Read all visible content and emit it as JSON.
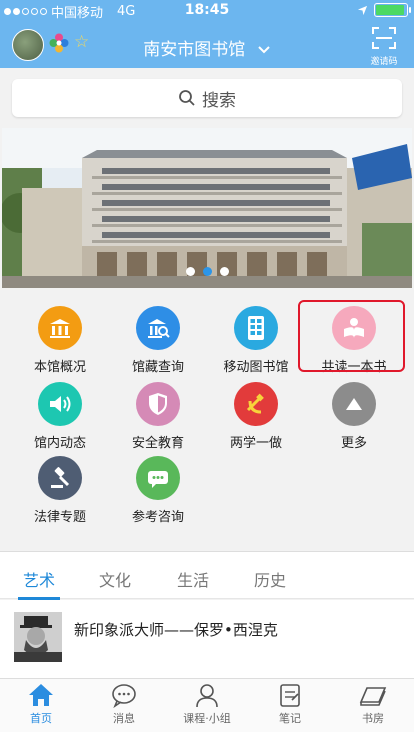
{
  "status_bar": {
    "carrier": "中国移动",
    "network": "4G",
    "time": "18:45",
    "battery_level": 0.85
  },
  "header": {
    "title": "南安市图书馆",
    "scan_label": "邀请码"
  },
  "search": {
    "placeholder": "搜索"
  },
  "banner": {
    "page_count": 3,
    "active_page": 2
  },
  "features": [
    {
      "label": "本馆概况",
      "icon": "library-building-icon",
      "color": "#f39c12"
    },
    {
      "label": "馆藏查询",
      "icon": "search-building-icon",
      "color": "#2e8ee6"
    },
    {
      "label": "移动图书馆",
      "icon": "mobile-library-icon",
      "color": "#2aa9e0"
    },
    {
      "label": "共读一本书",
      "icon": "reading-icon",
      "color": "#f6a9bd"
    },
    {
      "label": "馆内动态",
      "icon": "speaker-icon",
      "color": "#1dc7b1"
    },
    {
      "label": "安全教育",
      "icon": "shield-icon",
      "color": "#d58ab6"
    },
    {
      "label": "两学一做",
      "icon": "party-emblem-icon",
      "color": "#e23b3b"
    },
    {
      "label": "更多",
      "icon": "up-arrow-icon",
      "color": "#8c8c8c"
    },
    {
      "label": "法律专题",
      "icon": "gavel-icon",
      "color": "#4f5d73"
    },
    {
      "label": "参考咨询",
      "icon": "chat-bubble-icon",
      "color": "#59b85a"
    }
  ],
  "category_tabs": [
    "艺术",
    "文化",
    "生活",
    "历史"
  ],
  "active_tab": "艺术",
  "article": {
    "title": "新印象派大师——保罗•西涅克"
  },
  "bottom_nav": [
    {
      "label": "首页",
      "icon": "home-icon"
    },
    {
      "label": "消息",
      "icon": "message-icon"
    },
    {
      "label": "课程·小组",
      "icon": "person-icon"
    },
    {
      "label": "笔记",
      "icon": "note-icon"
    },
    {
      "label": "书房",
      "icon": "book-icon"
    }
  ],
  "colors": {
    "header_bg": "#6cb6ef",
    "accent": "#1e88d8",
    "highlight_border": "#e0182b"
  }
}
